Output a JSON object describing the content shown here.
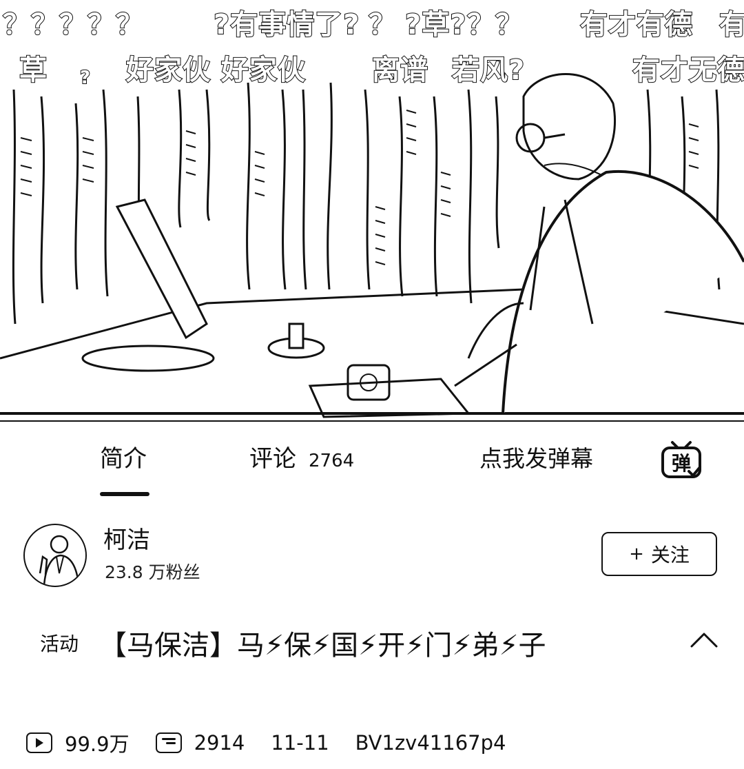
{
  "video": {
    "danmaku_row1": [
      "？？？？？",
      "?有事情了?",
      "？",
      "?草?",
      "？？",
      "有才有德",
      "有"
    ],
    "danmaku_row2": [
      "草",
      "?",
      "好家伙 好家伙",
      "离谱",
      "若风?",
      "有才无德"
    ]
  },
  "tabs": {
    "intro": "简介",
    "comments": "评论",
    "comments_count": "2764",
    "danmaku_input": "点我发弹幕",
    "danmaku_icon": "danmaku-toggle-icon"
  },
  "uploader": {
    "name": "柯洁",
    "fans": "23.8 万粉丝",
    "follow_label": "关注",
    "follow_icon": "plus-icon"
  },
  "title": {
    "badge": "活动",
    "text": "【马保洁】马⚡保⚡国⚡开⚡门⚡弟⚡子"
  },
  "stats": {
    "views": "99.9万",
    "danmaku_count": "2914",
    "date": "11-11",
    "bvid": "BV1zv41167p4"
  },
  "colors": {
    "ink": "#111111",
    "background": "#ffffff"
  }
}
